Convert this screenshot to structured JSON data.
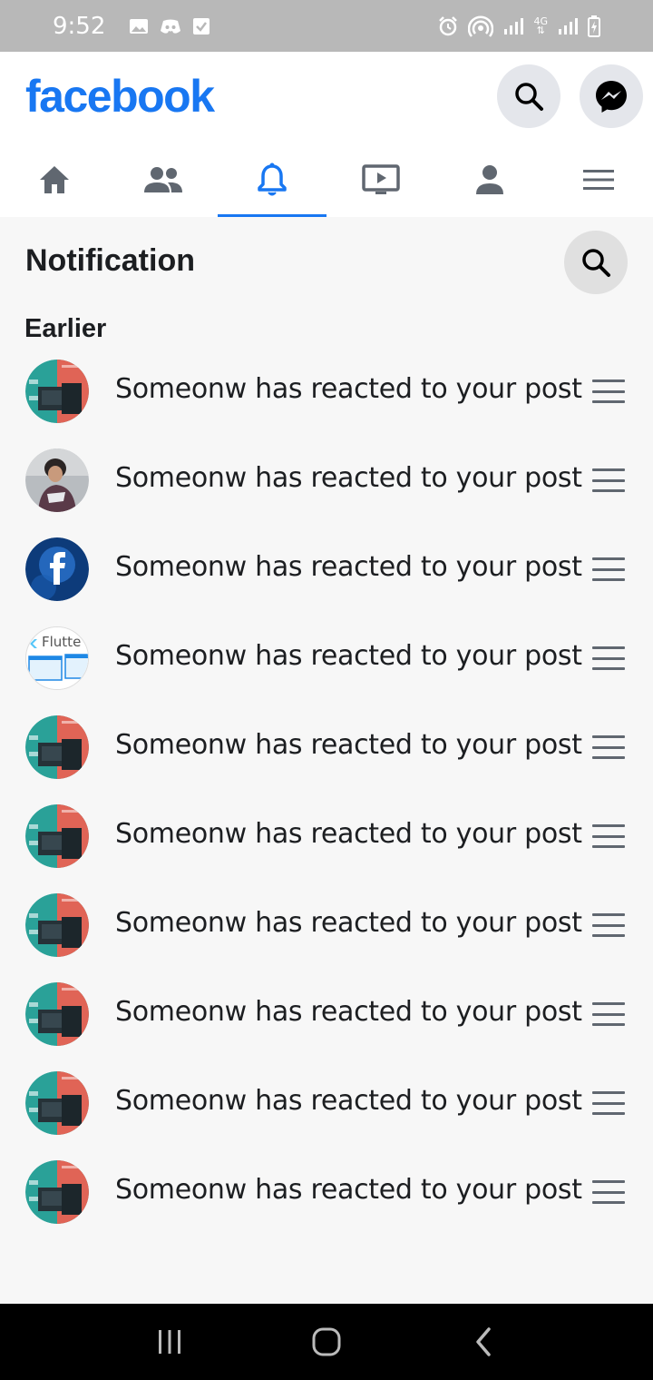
{
  "status_bar": {
    "time": "9:52",
    "network_label": "4G"
  },
  "header": {
    "logo": "facebook",
    "search_icon": "search-icon",
    "messenger_icon": "messenger-icon",
    "accent_color": "#1877f2"
  },
  "tabs": [
    {
      "name": "home",
      "icon": "home-icon",
      "active": false
    },
    {
      "name": "friends",
      "icon": "friends-icon",
      "active": false
    },
    {
      "name": "notifications",
      "icon": "bell-icon",
      "active": true
    },
    {
      "name": "watch",
      "icon": "video-icon",
      "active": false
    },
    {
      "name": "profile",
      "icon": "person-icon",
      "active": false
    },
    {
      "name": "menu",
      "icon": "menu-icon",
      "active": false
    }
  ],
  "notifications": {
    "title": "Notification",
    "section_label": "Earlier",
    "items": [
      {
        "avatar": "course-thumbnail-avatar",
        "text": "Someonw has reacted to your post"
      },
      {
        "avatar": "person-photo-avatar",
        "text": "Someonw has reacted to your post"
      },
      {
        "avatar": "facebook-logo-avatar",
        "text": "Someonw has reacted to your post"
      },
      {
        "avatar": "flutter-avatar",
        "text": "Someonw has reacted to your post",
        "avatar_text": "Flutte"
      },
      {
        "avatar": "course-thumbnail-avatar",
        "text": "Someonw has reacted to your post"
      },
      {
        "avatar": "course-thumbnail-avatar",
        "text": "Someonw has reacted to your post"
      },
      {
        "avatar": "course-thumbnail-avatar",
        "text": "Someonw has reacted to your post"
      },
      {
        "avatar": "course-thumbnail-avatar",
        "text": "Someonw has reacted to your post"
      },
      {
        "avatar": "course-thumbnail-avatar",
        "text": "Someonw has reacted to your post"
      },
      {
        "avatar": "course-thumbnail-avatar",
        "text": "Someonw has reacted to your post"
      }
    ]
  }
}
